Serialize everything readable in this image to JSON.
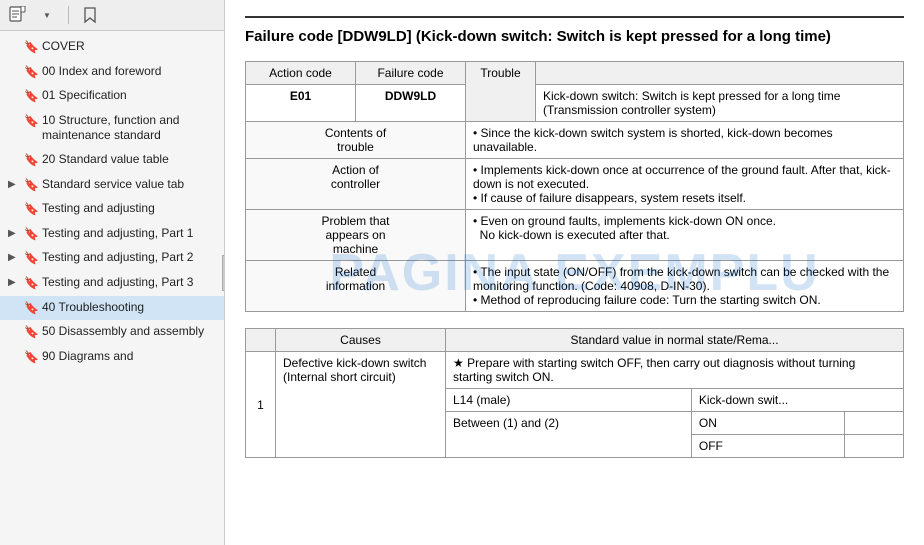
{
  "sidebar": {
    "toolbar": {
      "page_icon": "📄",
      "bookmark_icon": "🔖"
    },
    "items": [
      {
        "id": "cover",
        "label": "COVER",
        "expandable": false,
        "level": 0
      },
      {
        "id": "00-index",
        "label": "00 Index and foreword",
        "expandable": false,
        "level": 0
      },
      {
        "id": "01-spec",
        "label": "01 Specification",
        "expandable": false,
        "level": 0
      },
      {
        "id": "10-structure",
        "label": "10 Structure, function and maintenance standard",
        "expandable": false,
        "level": 0
      },
      {
        "id": "20-standard",
        "label": "20 Standard value table",
        "expandable": false,
        "level": 0
      },
      {
        "id": "std-service",
        "label": "Standard service value tab",
        "expandable": true,
        "level": 0
      },
      {
        "id": "testing-adj",
        "label": "Testing and adjusting",
        "expandable": true,
        "level": 0
      },
      {
        "id": "testing-adj-p1",
        "label": "Testing and adjusting, Part 1",
        "expandable": true,
        "level": 0
      },
      {
        "id": "testing-adj-p2",
        "label": "Testing and adjusting, Part 2",
        "expandable": true,
        "level": 0
      },
      {
        "id": "testing-adj-p3",
        "label": "Testing and adjusting, Part 3",
        "expandable": true,
        "level": 0
      },
      {
        "id": "40-trouble",
        "label": "40 Troubleshooting",
        "expandable": false,
        "level": 0,
        "active": true
      },
      {
        "id": "50-disassembly",
        "label": "50 Disassembly and assembly",
        "expandable": false,
        "level": 0
      },
      {
        "id": "90-diagrams",
        "label": "90 Diagrams and",
        "expandable": false,
        "level": 0
      }
    ]
  },
  "main": {
    "title": "Failure code [DDW9LD] (Kick-down switch: Switch is kept pressed for a long time)",
    "title_short": "Failure code [DDW9LD] (Kick-down switch: Switch is ke...\nlong time)",
    "table1": {
      "headers": [
        "Action code",
        "Failure code",
        "Trouble"
      ],
      "action_code": "E01",
      "failure_code": "DDW9LD",
      "trouble_label": "Trouble",
      "trouble_desc": "Kick-down switch: Switch is kept pressed for a long time (Transmission controller system)",
      "rows": [
        {
          "header": "Contents of trouble",
          "content": "Since the kick-down switch system is shorted, kick-down becomes unavailable."
        },
        {
          "header": "Action of controller",
          "content": "• Implements kick-down once at occurrence of the ground fault. After that, kick-down is not executed.\n• If cause of failure disappears, system resets itself."
        },
        {
          "header": "Problem that appears on machine",
          "content": "• Even on ground faults, implements kick-down ON once.\n  No kick-down is executed after that."
        },
        {
          "header": "Related information",
          "content": "• The input state (ON/OFF) from the kick-down switch can be checked with the monitoring function. (Code: 40908, D-IN-30).\n• Method of reproducing failure code: Turn the starting switch ON."
        }
      ]
    },
    "table2": {
      "headers": [
        "",
        "Causes",
        "Standard value in normal state/Rema..."
      ],
      "rows": [
        {
          "num": "1",
          "cause": "Defective kick-down switch (Internal short circuit)",
          "sub_rows": [
            {
              "label": "★ Prepare with starting switch OFF, then carry out diagnosis without turning starting switch ON.",
              "connector": "L14 (male)",
              "value_header": "Kick-down swit...",
              "values": [
                {
                  "label": "Between (1) and (2)",
                  "states": [
                    "ON",
                    "OFF"
                  ]
                }
              ]
            }
          ]
        }
      ]
    }
  },
  "watermark": "PAGINA EXEMPLU"
}
